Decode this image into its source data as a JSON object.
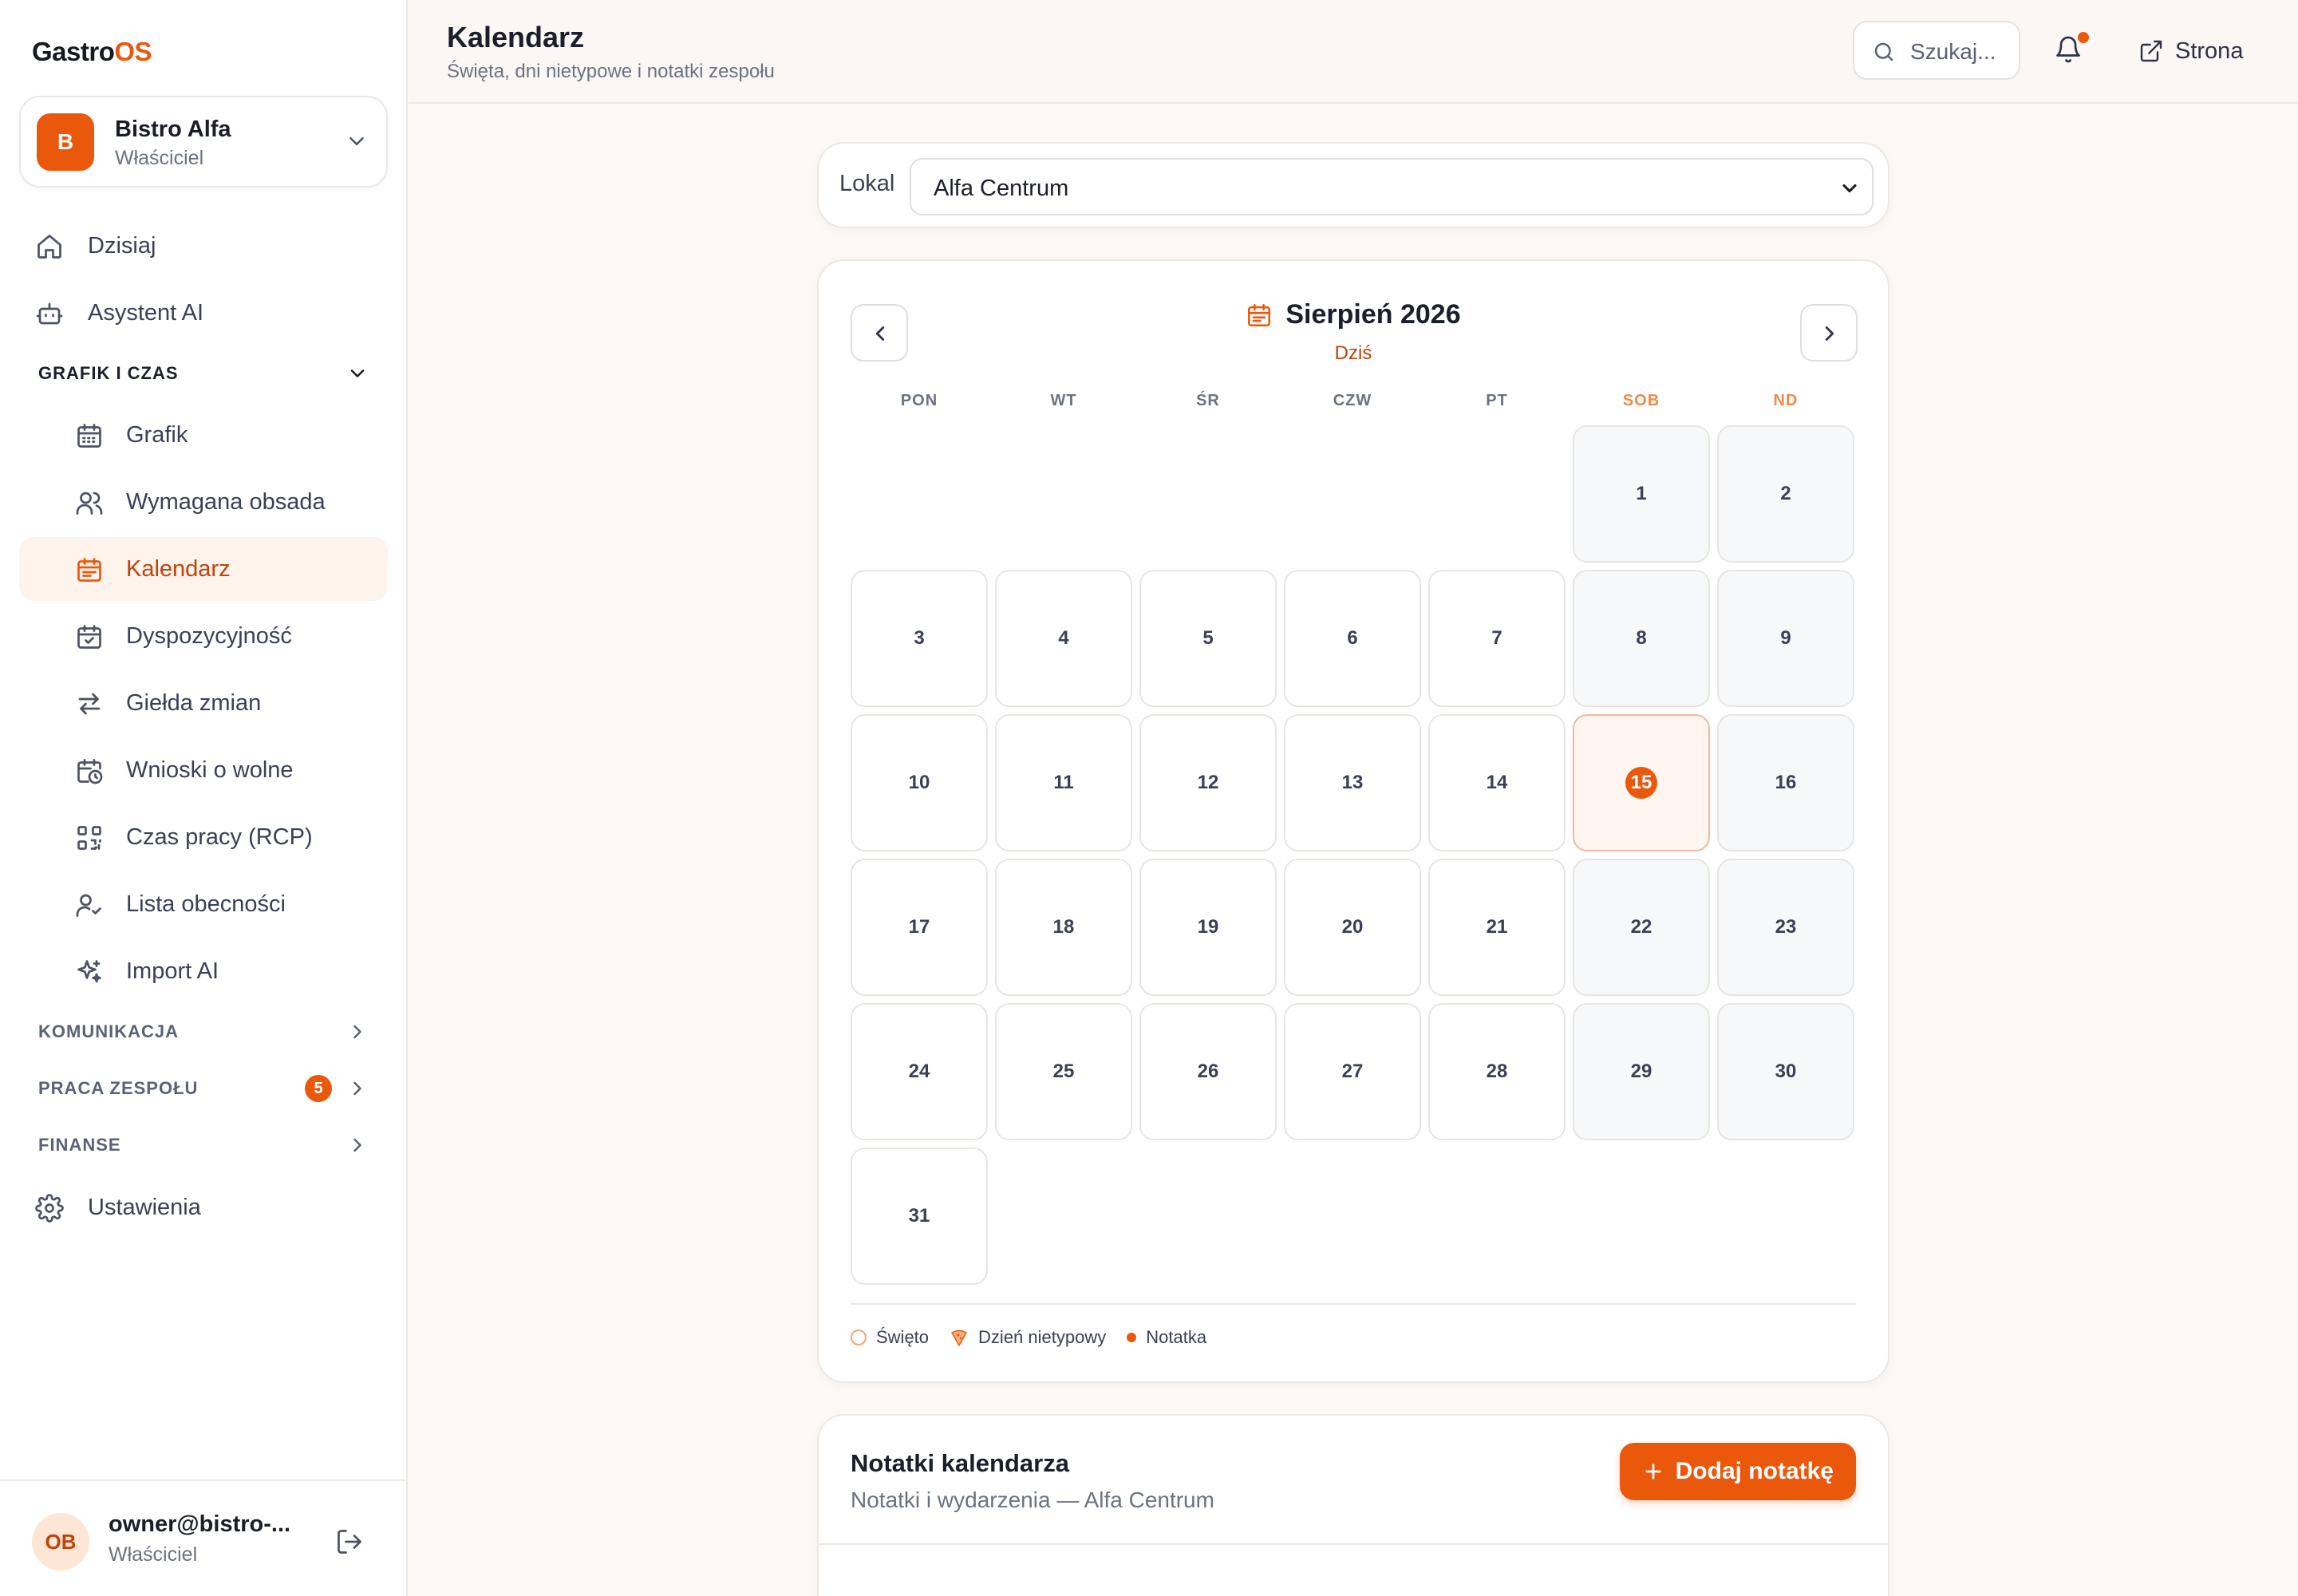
{
  "app": {
    "logo_main": "Gastro",
    "logo_accent": "OS",
    "accent_color": "#ea580c"
  },
  "tenant": {
    "avatar": "B",
    "name": "Bistro Alfa",
    "role": "Właściciel"
  },
  "sidebar": {
    "top_items": [
      {
        "label": "Dzisiaj",
        "icon": "home-icon"
      },
      {
        "label": "Asystent AI",
        "icon": "bot-icon"
      }
    ],
    "schedule_section": {
      "label": "GRAFIK I CZAS",
      "expanded": true
    },
    "schedule_items": [
      {
        "label": "Grafik",
        "icon": "calendar-grid-icon"
      },
      {
        "label": "Wymagana obsada",
        "icon": "users-icon"
      },
      {
        "label": "Kalendarz",
        "icon": "calendar-list-icon",
        "active": true
      },
      {
        "label": "Dyspozycyjność",
        "icon": "calendar-check-icon"
      },
      {
        "label": "Giełda zmian",
        "icon": "swap-icon"
      },
      {
        "label": "Wnioski o wolne",
        "icon": "calendar-clock-icon"
      },
      {
        "label": "Czas pracy (RCP)",
        "icon": "qr-code-icon"
      },
      {
        "label": "Lista obecności",
        "icon": "user-check-icon"
      },
      {
        "label": "Import AI",
        "icon": "sparkles-icon"
      }
    ],
    "collapsed_sections": [
      {
        "label": "KOMUNIKACJA"
      },
      {
        "label": "PRACA ZESPOŁU",
        "badge": "5"
      },
      {
        "label": "FINANSE"
      }
    ],
    "settings": {
      "label": "Ustawienia",
      "icon": "gear-icon"
    }
  },
  "user": {
    "avatar": "OB",
    "email": "owner@bistro-...",
    "role": "Właściciel"
  },
  "header": {
    "title": "Kalendarz",
    "subtitle": "Święta, dni nietypowe i notatki zespołu",
    "search_placeholder": "Szukaj...",
    "site_label": "Strona"
  },
  "location": {
    "label": "Lokal",
    "selected": "Alfa Centrum"
  },
  "calendar": {
    "month_label": "Sierpień 2026",
    "today_label": "Dziś",
    "weekdays": [
      "PON",
      "WT",
      "ŚR",
      "CZW",
      "PT",
      "SOB",
      "ND"
    ],
    "first_weekday_index": 5,
    "days_in_month": 31,
    "today": 15
  },
  "legend": [
    {
      "label": "Święto",
      "icon": "ring-dot"
    },
    {
      "label": "Dzień nietypowy",
      "icon": "pizza-slice-icon"
    },
    {
      "label": "Notatka",
      "icon": "filled-dot"
    }
  ],
  "notes": {
    "title": "Notatki kalendarza",
    "subtitle": "Notatki i wydarzenia — Alfa Centrum",
    "add_label": "Dodaj notatkę"
  }
}
